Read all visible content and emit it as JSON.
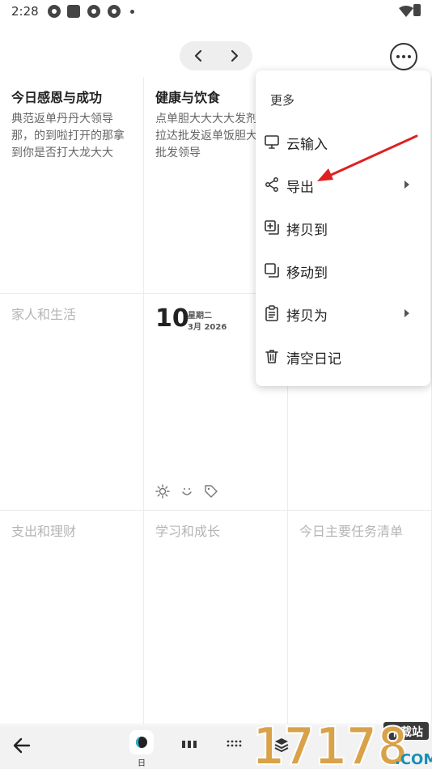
{
  "status_bar": {
    "time": "2:28"
  },
  "grid": {
    "cells": [
      {
        "title": "今日感恩与成功",
        "body": "典范返单丹丹大领导那，的到啦打开的那拿到你是否打大龙大大"
      },
      {
        "title": "健康与饮食",
        "body": "点单胆大大大大发剂飞拉达批发返单饭胆大打批发领导"
      },
      {
        "title": "家人和生活",
        "body": ""
      },
      {
        "title": "支出和理财",
        "body": ""
      },
      {
        "title": "学习和成长",
        "body": ""
      },
      {
        "title": "今日主要任务清单",
        "body": ""
      }
    ]
  },
  "date_cell": {
    "day": "10",
    "weekday": "星期二",
    "month_year": "3月 2026"
  },
  "menu": {
    "header": "更多",
    "items": [
      {
        "label": "云输入",
        "icon": "monitor-icon"
      },
      {
        "label": "导出",
        "icon": "share-icon"
      },
      {
        "label": "拷贝到",
        "icon": "copy-plus-icon"
      },
      {
        "label": "移动到",
        "icon": "move-icon"
      },
      {
        "label": "拷贝为",
        "icon": "clipboard-icon"
      },
      {
        "label": "清空日记",
        "icon": "trash-icon"
      }
    ]
  },
  "bottom_bar": {
    "day_label": "日"
  },
  "watermark": {
    "text": "17178",
    "tag": "下载站",
    "domain": ".COM"
  },
  "colors": {
    "annotation_arrow": "#e02020",
    "accent": "#1a8fb8"
  }
}
